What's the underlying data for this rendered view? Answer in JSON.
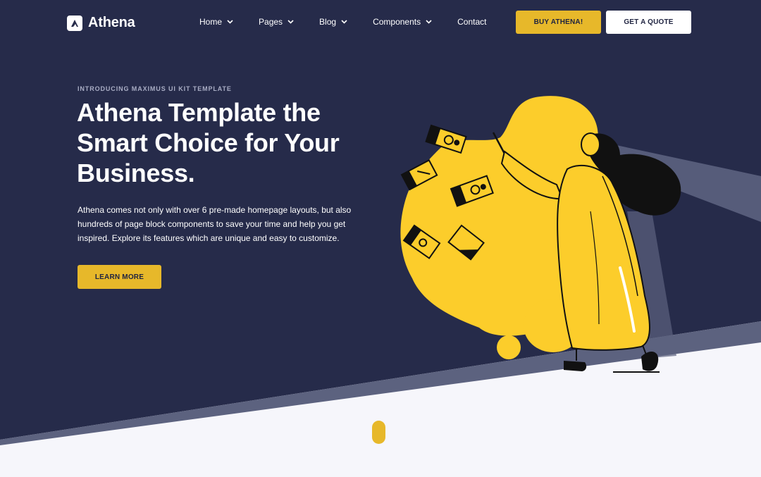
{
  "brand": {
    "name": "Athena",
    "logo_icon": "athena-logo-icon"
  },
  "nav": {
    "items": [
      {
        "label": "Home",
        "has_dropdown": true
      },
      {
        "label": "Pages",
        "has_dropdown": true
      },
      {
        "label": "Blog",
        "has_dropdown": true
      },
      {
        "label": "Components",
        "has_dropdown": true
      },
      {
        "label": "Contact",
        "has_dropdown": false
      }
    ]
  },
  "header_actions": {
    "buy_label": "BUY ATHENA!",
    "quote_label": "GET A QUOTE"
  },
  "hero": {
    "eyebrow": "INTRODUCING MAXIMUS UI KIT TEMPLATE",
    "title_lines": [
      "Athena Template the",
      "Smart Choice for Your",
      "Business."
    ],
    "description": "Athena comes not only with over 6 pre-made homepage layouts, but also hundreds of page block components to save your time and help you get inspired. Explore its features which are unique and easy to customize.",
    "cta_label": "LEARN MORE"
  },
  "colors": {
    "navy": "#262b4a",
    "accent_yellow": "#e7b82a",
    "illustration_yellow": "#fccd2b",
    "light_bg": "#f6f6fb",
    "stripe": "#5c627f"
  }
}
